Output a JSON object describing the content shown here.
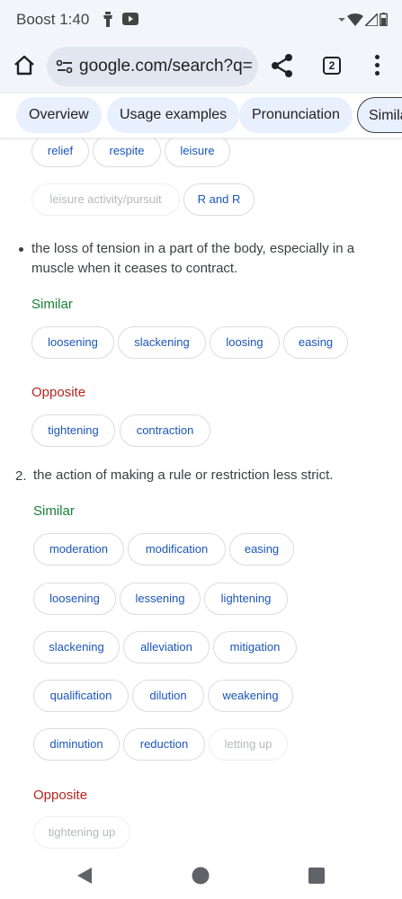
{
  "status_bar": {
    "time": "Boost 1:40"
  },
  "browser": {
    "url": "google.com/search?q=re",
    "tab_count": "2"
  },
  "section_tabs": [
    "Overview",
    "Usage examples",
    "Pronunciation",
    "Simila"
  ],
  "sense1": {
    "top_chips_row1": [
      "relief",
      "respite",
      "leisure"
    ],
    "top_chips_row2": [
      {
        "label": "leisure activity/pursuit",
        "enabled": false
      },
      {
        "label": "R and R",
        "enabled": true
      }
    ],
    "definition": "the loss of tension in a part of the body, especially in a muscle when it ceases to contract.",
    "similar_label": "Similar",
    "similar": [
      "loosening",
      "slackening",
      "loosing",
      "easing"
    ],
    "opposite_label": "Opposite",
    "opposite": [
      "tightening",
      "contraction"
    ]
  },
  "sense2": {
    "number": "2.",
    "definition": "the action of making a rule or restriction less strict.",
    "similar_label": "Similar",
    "similar_rows": [
      [
        "moderation",
        "modification",
        "easing"
      ],
      [
        "loosening",
        "lessening",
        "lightening"
      ],
      [
        "slackening",
        "alleviation",
        "mitigation"
      ],
      [
        "qualification",
        "dilution",
        "weakening"
      ],
      [
        "diminution",
        "reduction",
        "letting up"
      ]
    ],
    "disabled_similar": [
      "letting up"
    ],
    "opposite_label": "Opposite",
    "opposite": [
      "tightening up"
    ],
    "disabled_opposite": [
      "tightening up"
    ]
  },
  "colors": {
    "similar": "#188038",
    "opposite": "#b3261e",
    "chip_text": "#1a56b8",
    "tab_bg": "#e8f0fe"
  },
  "icons": [
    "home-icon",
    "site-settings-icon",
    "share-icon",
    "tab-switcher-icon",
    "more-options-icon",
    "back-icon",
    "home-circle-icon",
    "recents-icon"
  ]
}
